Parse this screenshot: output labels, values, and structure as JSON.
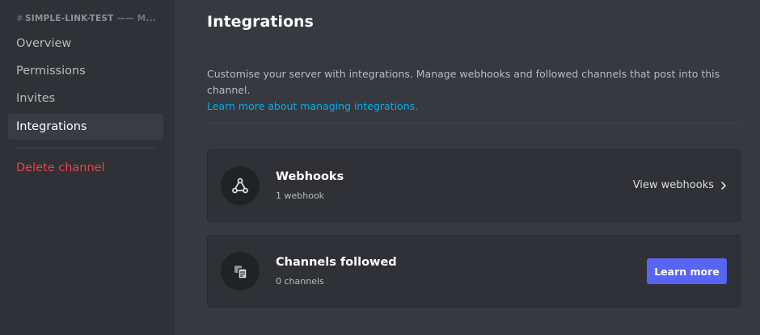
{
  "sidebar": {
    "header": {
      "hash": "#",
      "channel": "SIMPLE-LINK-TEST",
      "suffix": "—— M..."
    },
    "items": [
      {
        "label": "Overview"
      },
      {
        "label": "Permissions"
      },
      {
        "label": "Invites"
      },
      {
        "label": "Integrations",
        "active": true
      }
    ],
    "danger_item": {
      "label": "Delete channel"
    }
  },
  "main": {
    "title": "Integrations",
    "description": "Customise your server with integrations. Manage webhooks and followed channels that post into this channel.",
    "learn_link": "Learn more about managing integrations.",
    "cards": {
      "webhooks": {
        "icon": "webhook-icon",
        "title": "Webhooks",
        "subtitle": "1 webhook",
        "action": "View webhooks"
      },
      "channels_followed": {
        "icon": "channels-followed-icon",
        "title": "Channels followed",
        "subtitle": "0 channels",
        "action": "Learn more"
      }
    }
  },
  "colors": {
    "sidebar_bg": "#2f3136",
    "main_bg": "#36393f",
    "card_bg": "#2f3136",
    "accent": "#5865f2",
    "link": "#00aff4",
    "danger": "#ed4245"
  }
}
